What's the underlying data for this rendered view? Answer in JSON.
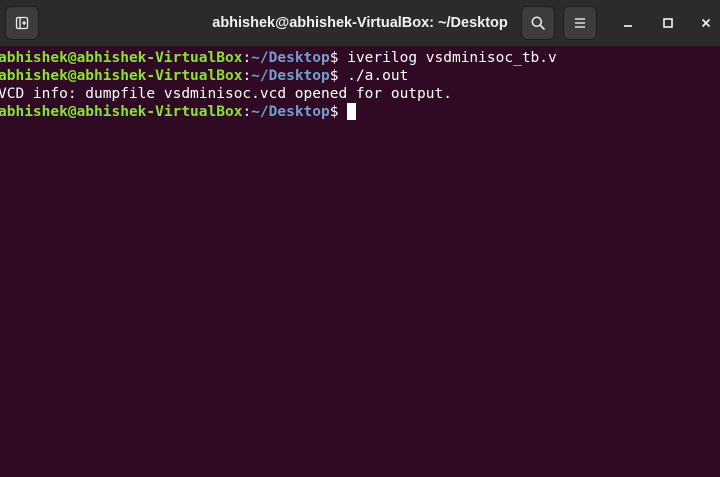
{
  "window": {
    "title": "abhishek@abhishek-VirtualBox: ~/Desktop"
  },
  "header_buttons": {
    "new_tab_icon": "new-tab-icon",
    "search_icon": "search-icon",
    "menu_icon": "hamburger-menu-icon",
    "minimize_icon": "minimize-icon",
    "maximize_icon": "maximize-icon",
    "close_icon": "close-icon"
  },
  "colors": {
    "terminal_bg": "#300a24",
    "user_host": "#8ae234",
    "path": "#729fcf",
    "text": "#ffffff",
    "titlebar_bg": "#2b2b2b"
  },
  "terminal": {
    "lines": [
      {
        "user_host": "abhishek@abhishek-VirtualBox",
        "separator": ":",
        "path": "~/Desktop",
        "prompt": "$ ",
        "command": "iverilog vsdminisoc_tb.v"
      },
      {
        "user_host": "abhishek@abhishek-VirtualBox",
        "separator": ":",
        "path": "~/Desktop",
        "prompt": "$ ",
        "command": "./a.out"
      },
      {
        "output": "VCD info: dumpfile vsdminisoc.vcd opened for output."
      },
      {
        "user_host": "abhishek@abhishek-VirtualBox",
        "separator": ":",
        "path": "~/Desktop",
        "prompt": "$ ",
        "command": ""
      }
    ]
  }
}
